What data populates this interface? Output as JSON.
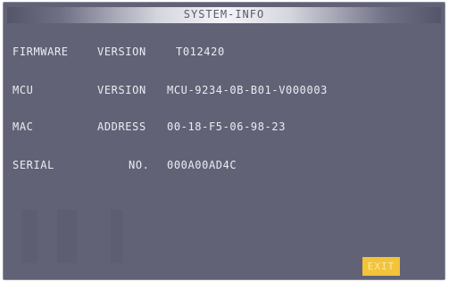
{
  "window": {
    "title": "SYSTEM-INFO"
  },
  "info": {
    "firmware": {
      "label": "FIRMWARE",
      "key": "VERSION",
      "value": "T012420"
    },
    "mcu": {
      "label": "MCU",
      "key": "VERSION",
      "value": "MCU-9234-0B-B01-V000003"
    },
    "mac": {
      "label": "MAC",
      "key": "ADDRESS",
      "value": "00-18-F5-06-98-23"
    },
    "serial": {
      "label": "SERIAL",
      "key": "NO.",
      "value": "000A00AD4C"
    }
  },
  "actions": {
    "exit_label": "EXIT"
  },
  "colors": {
    "background": "#626277",
    "text": "#ececf2",
    "exit_button": "#f3c339"
  }
}
